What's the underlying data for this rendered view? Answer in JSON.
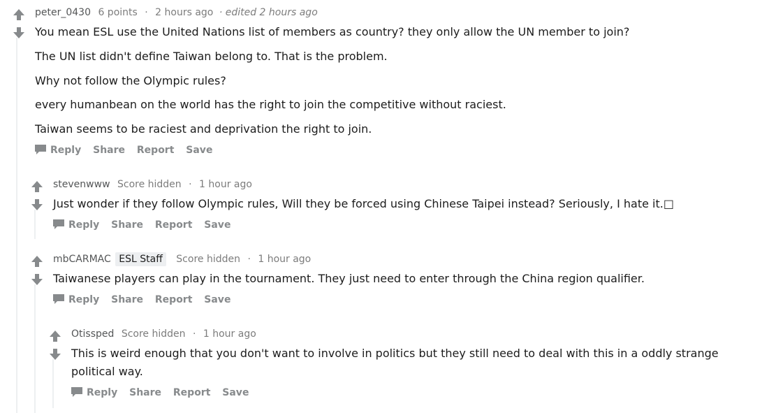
{
  "actions": {
    "reply": "Reply",
    "share": "Share",
    "report": "Report",
    "save": "Save"
  },
  "comments": [
    {
      "author": "peter_0430",
      "score": "6 points",
      "time": "2 hours ago",
      "edited": "· edited 2 hours ago",
      "paragraphs": [
        "You mean ESL use the United Nations list of members as country? they only allow the UN member to join?",
        "The UN list didn't define Taiwan belong to. That is the problem.",
        "Why not follow the Olympic rules?",
        "every humanbean on the world has the right to join the competitive without raciest.",
        "Taiwan seems to be raciest and deprivation the right to join."
      ]
    },
    {
      "author": "stevenwww",
      "score": "Score hidden",
      "time": "1 hour ago",
      "paragraphs": [
        "Just wonder if they follow Olympic rules, Will they be forced using Chinese Taipei instead? Seriously, I hate it.□"
      ]
    },
    {
      "author": "mbCARMAC",
      "flair": "ESL Staff",
      "score": "Score hidden",
      "time": "1 hour ago",
      "paragraphs": [
        "Taiwanese players can play in the tournament. They just need to enter through the China region qualifier."
      ]
    },
    {
      "author": "Otissped",
      "score": "Score hidden",
      "time": "1 hour ago",
      "paragraphs": [
        "This is weird enough that you don't want to involve in politics but they still need to deal with this in a oddly strange political way."
      ]
    }
  ],
  "colors": {
    "arrow": "#878a8c",
    "thread_line": "#edeff1",
    "flair_bg": "#edeff1"
  }
}
